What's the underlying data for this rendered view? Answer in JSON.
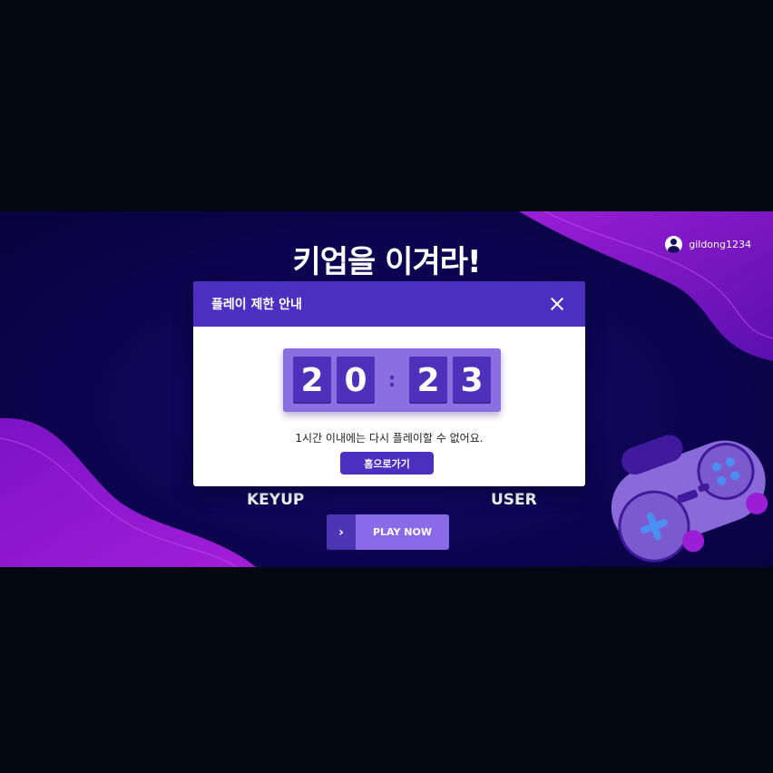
{
  "header": {
    "title": "키업을 이겨라!",
    "username": "gildong1234",
    "user_icon": "user-circle-icon"
  },
  "labels": {
    "left": "KEYUP",
    "right": "USER"
  },
  "play_button": {
    "label": "PLAY NOW",
    "icon": "chevron-right-icon"
  },
  "modal": {
    "title": "플레이 제한 안내",
    "close_icon": "close-icon",
    "timer": {
      "d1": "2",
      "d2": "0",
      "separator": ":",
      "d3": "2",
      "d4": "3"
    },
    "message": "1시간 이내에는 다시 플레이할 수 없어요.",
    "home_button": "홈으로가기"
  },
  "colors": {
    "accent": "#4b2fbe",
    "timer_bg": "#8a6fe0",
    "background": "#08023d"
  }
}
